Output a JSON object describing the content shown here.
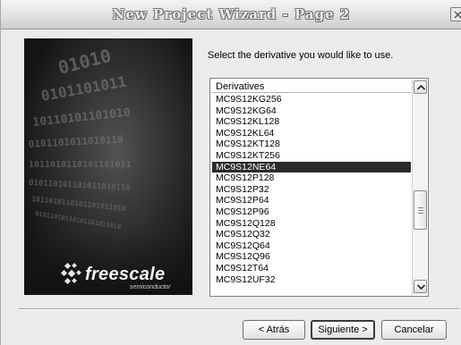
{
  "window": {
    "title": "New Project Wizard - Page  2",
    "close_icon": "close-icon"
  },
  "branding": {
    "logo_text": "freescale",
    "logo_subtext": "semiconductor"
  },
  "content": {
    "instruction": "Select the derivative you would like to use."
  },
  "derivatives_list": {
    "header": "Derivatives",
    "items": [
      "MC9S12KG256",
      "MC9S12KG64",
      "MC9S12KL128",
      "MC9S12KL64",
      "MC9S12KT128",
      "MC9S12KT256",
      "MC9S12NE64",
      "MC9S12P128",
      "MC9S12P32",
      "MC9S12P64",
      "MC9S12P96",
      "MC9S12Q128",
      "MC9S12Q32",
      "MC9S12Q64",
      "MC9S12Q96",
      "MC9S12T64",
      "MC9S12UF32"
    ],
    "selected": "MC9S12NE64"
  },
  "buttons": {
    "back": "< Atrás",
    "next": "Siguiente >",
    "cancel": "Cancelar"
  },
  "colors": {
    "selection_bg": "#2b2b2b",
    "panel_bg": "#1e1e1e"
  }
}
